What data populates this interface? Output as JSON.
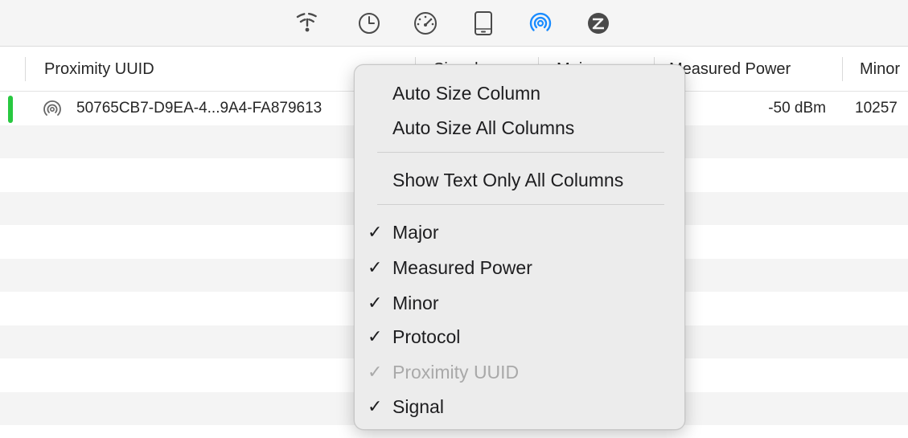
{
  "toolbar": {
    "icons": [
      {
        "name": "wifi-icon",
        "color": "#4a4a4a"
      },
      {
        "name": "clock-icon",
        "color": "#4a4a4a"
      },
      {
        "name": "speedometer-icon",
        "color": "#4a4a4a"
      },
      {
        "name": "phone-device-icon",
        "color": "#4a4a4a"
      },
      {
        "name": "ibeacon-icon",
        "color": "#1a8cff",
        "selected": true
      },
      {
        "name": "zigbee-icon",
        "color": "#4a4a4a"
      }
    ]
  },
  "table": {
    "columns": {
      "proximity_uuid": "Proximity UUID",
      "signal": "Signal",
      "major": "Major",
      "measured_power": "Measured Power",
      "minor": "Minor"
    },
    "rows": [
      {
        "signal_color": "#28c840",
        "icon": "ibeacon-icon",
        "proximity_uuid": "50765CB7-D9EA-4...9A4-FA879613",
        "measured_power": "-50 dBm",
        "minor": "10257"
      }
    ]
  },
  "context_menu": {
    "auto_size_column": "Auto Size Column",
    "auto_size_all_columns": "Auto Size All Columns",
    "show_text_only_all_columns": "Show Text Only All Columns",
    "check_mark": "✓",
    "column_toggles": [
      {
        "label": "Major",
        "checked": true,
        "enabled": true
      },
      {
        "label": "Measured Power",
        "checked": true,
        "enabled": true
      },
      {
        "label": "Minor",
        "checked": true,
        "enabled": true
      },
      {
        "label": "Protocol",
        "checked": true,
        "enabled": true
      },
      {
        "label": "Proximity UUID",
        "checked": true,
        "enabled": false
      },
      {
        "label": "Signal",
        "checked": true,
        "enabled": true
      }
    ]
  }
}
